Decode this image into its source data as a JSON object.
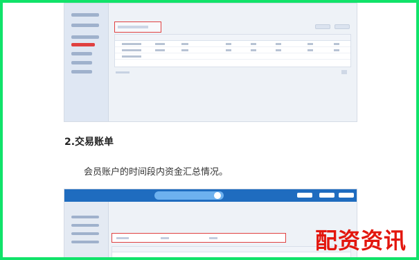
{
  "section_heading": "2.交易账单",
  "paragraph": "会员账户的时间段内资金汇总情况。",
  "watermark": "配资资讯"
}
